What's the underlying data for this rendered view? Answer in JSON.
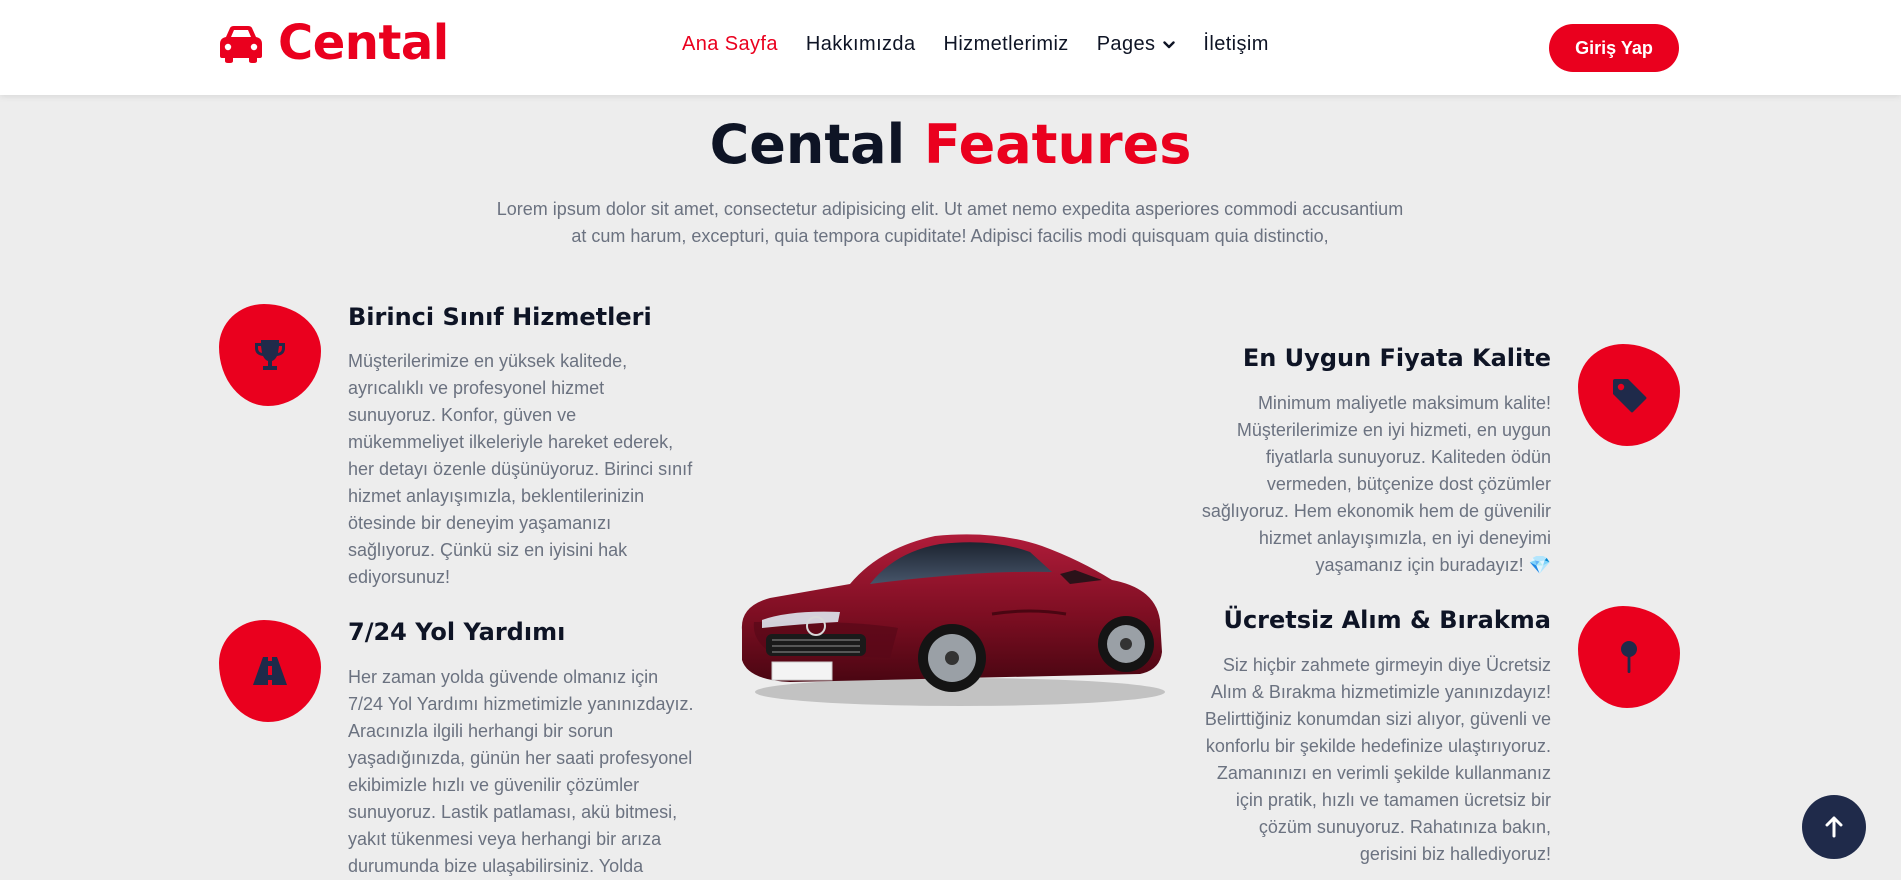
{
  "brand": {
    "name": "Cental",
    "icon": "car-icon"
  },
  "nav": {
    "items": [
      {
        "label": "Ana Sayfa",
        "active": true
      },
      {
        "label": "Hakkımızda",
        "active": false
      },
      {
        "label": "Hizmetlerimiz",
        "active": false
      },
      {
        "label": "Pages",
        "active": false,
        "has_dropdown": true
      },
      {
        "label": "İletişim",
        "active": false
      }
    ],
    "login_label": "Giriş Yap"
  },
  "section": {
    "title_part1": "Cental",
    "title_part2": "Features",
    "description": "Lorem ipsum dolor sit amet, consectetur adipisicing elit. Ut amet nemo expedita asperiores commodi accusantium at cum harum, excepturi, quia tempora cupiditate! Adipisci facilis modi quisquam quia distinctio,"
  },
  "features": {
    "left": [
      {
        "icon": "trophy-icon",
        "title": "Birinci Sınıf Hizmetleri",
        "text": "Müşterilerimize en yüksek kalitede, ayrıcalıklı ve profesyonel hizmet sunuyoruz. Konfor, güven ve mükemmeliyet ilkeleriyle hareket ederek, her detayı özenle düşünüyoruz. Birinci sınıf hizmet anlayışımızla, beklentilerinizin ötesinde bir deneyim yaşamanızı sağlıyoruz. Çünkü siz en iyisini hak ediyorsunuz!"
      },
      {
        "icon": "road-icon",
        "title": "7/24 Yol Yardımı",
        "text": "Her zaman yolda güvende olmanız için 7/24 Yol Yardımı hizmetimizle yanınızdayız. Aracınızla ilgili herhangi bir sorun yaşadığınızda, günün her saati profesyonel ekibimizle hızlı ve güvenilir çözümler sunuyoruz. Lastik patlaması, akü bitmesi, yakıt tükenmesi veya herhangi bir arıza durumunda bize ulaşabilirsiniz. Yolda"
      }
    ],
    "right": [
      {
        "icon": "tag-icon",
        "title": "En Uygun Fiyata Kalite",
        "text": "Minimum maliyetle maksimum kalite! Müşterilerimize en iyi hizmeti, en uygun fiyatlarla sunuyoruz. Kaliteden ödün vermeden, bütçenize dost çözümler sağlıyoruz. Hem ekonomik hem de güvenilir hizmet anlayışımızla, en iyi deneyimi yaşamanız için buradayız! 💎"
      },
      {
        "icon": "map-pin-icon",
        "title": "Ücretsiz Alım & Bırakma",
        "text": "Siz hiçbir zahmete girmeyin diye Ücretsiz Alım & Bırakma hizmetimizle yanınızdayız! Belirttiğiniz konumdan sizi alıyor, güvenli ve konforlu bir şekilde hedefinize ulaştırıyoruz. Zamanınızı en verimli şekilde kullanmanız için pratik, hızlı ve tamamen ücretsiz bir çözüm sunuyoruz. Rahatınıza bakın, gerisini biz hallediyoruz!"
      }
    ]
  },
  "car_image": {
    "icon": "red-sports-car-image"
  },
  "back_to_top": {
    "icon": "arrow-up-icon"
  },
  "colors": {
    "accent": "#ea001e",
    "dark": "#0e1425",
    "muted": "#6b7280",
    "background": "#ededed"
  }
}
